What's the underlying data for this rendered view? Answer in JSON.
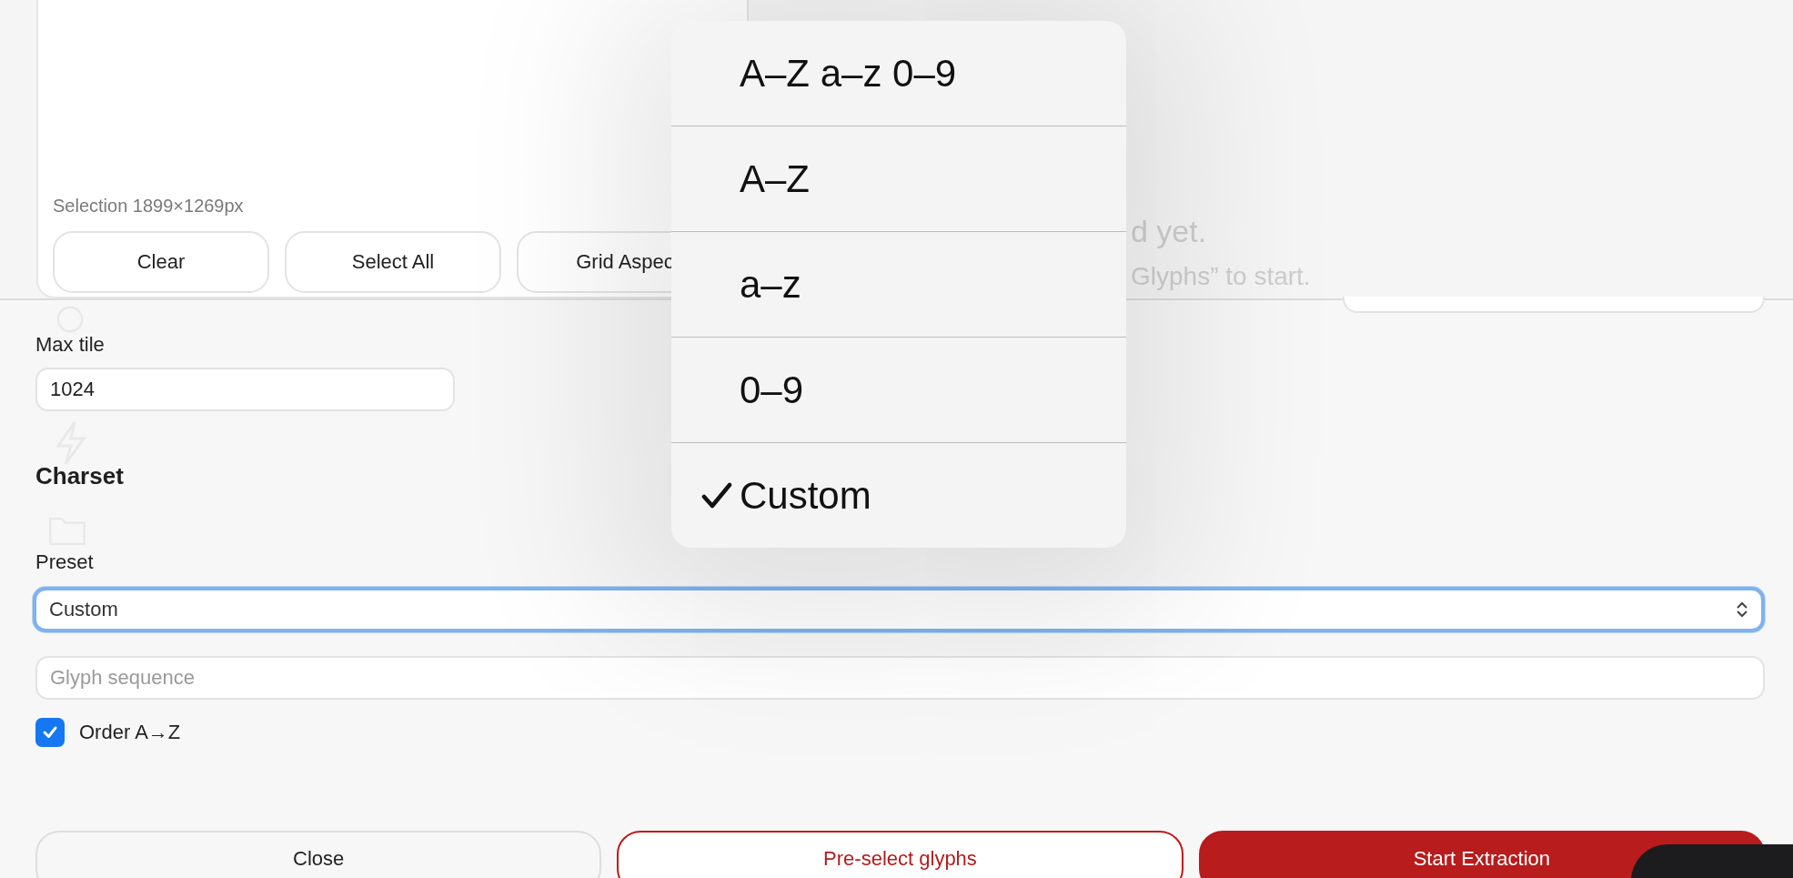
{
  "selection_panel": {
    "caption": "Selection 1899×1269px",
    "buttons": [
      "Clear",
      "Select All",
      "Grid Aspec"
    ]
  },
  "background_hint": [
    "d yet.",
    "Glyphs” to start."
  ],
  "max_tile": {
    "label": "Max tile",
    "value": "1024"
  },
  "charset": {
    "heading": "Charset",
    "preset": {
      "label": "Preset",
      "value": "Custom",
      "focused": true
    },
    "glyph_sequence": {
      "placeholder": "Glyph sequence"
    },
    "order": {
      "label": "Order A→Z",
      "checked": true
    }
  },
  "actions": [
    {
      "label": "Close",
      "kind": "plain"
    },
    {
      "label": "Pre-select glyphs",
      "kind": "outline"
    },
    {
      "label": "Start Extraction",
      "kind": "primary"
    }
  ],
  "dropdown": {
    "options": [
      {
        "label": "A–Z a–z 0–9",
        "selected": false
      },
      {
        "label": "A–Z",
        "selected": false
      },
      {
        "label": "a–z",
        "selected": false
      },
      {
        "label": "0–9",
        "selected": false
      },
      {
        "label": "Custom",
        "selected": true
      }
    ]
  }
}
